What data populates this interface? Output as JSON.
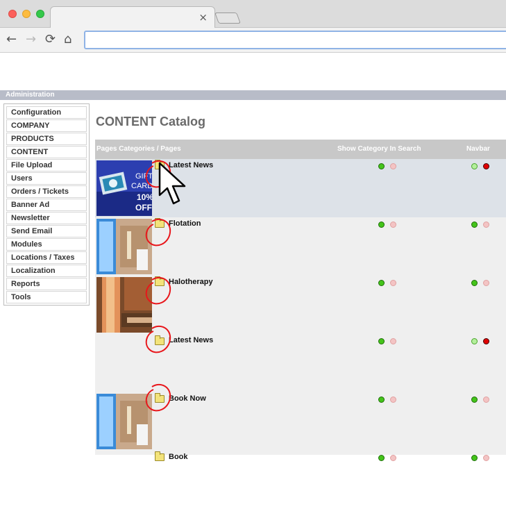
{
  "browser": {
    "tab_close": "×",
    "nav": {
      "back": "←",
      "forward": "→",
      "reload": "⟳",
      "home": "⌂"
    },
    "address_value": ""
  },
  "admin": {
    "header": "Administration"
  },
  "sidebar": {
    "items": [
      {
        "label": "Configuration"
      },
      {
        "label": "COMPANY"
      },
      {
        "label": "PRODUCTS"
      },
      {
        "label": "CONTENT"
      },
      {
        "label": "File Upload"
      },
      {
        "label": "Users"
      },
      {
        "label": "Orders / Tickets"
      },
      {
        "label": "Banner Ad"
      },
      {
        "label": "Newsletter"
      },
      {
        "label": "Send Email"
      },
      {
        "label": "Modules"
      },
      {
        "label": "Locations / Taxes"
      },
      {
        "label": "Localization"
      },
      {
        "label": "Reports"
      },
      {
        "label": "Tools"
      }
    ]
  },
  "main": {
    "title": "CONTENT Catalog",
    "columns": {
      "name": "Pages Categories / Pages",
      "search": "Show Category In Search",
      "navbar": "Navbar"
    },
    "rows": [
      {
        "label": "Latest News",
        "thumb": "gift-cards",
        "search": [
          "on",
          "off"
        ],
        "navbar": [
          "onlight",
          "red"
        ]
      },
      {
        "label": "Flotation",
        "thumb": "flotation",
        "search": [
          "on",
          "off"
        ],
        "navbar": [
          "on",
          "off"
        ]
      },
      {
        "label": "Halotherapy",
        "thumb": "halotherapy",
        "search": [
          "on",
          "off"
        ],
        "navbar": [
          "on",
          "off"
        ]
      },
      {
        "label": "Latest News",
        "thumb": "none",
        "search": [
          "on",
          "off"
        ],
        "navbar": [
          "onlight",
          "red"
        ]
      },
      {
        "label": "Book Now",
        "thumb": "flotation",
        "search": [
          "on",
          "off"
        ],
        "navbar": [
          "on",
          "off"
        ]
      },
      {
        "label": "Book",
        "thumb": "none",
        "search": [
          "on",
          "off"
        ],
        "navbar": [
          "on",
          "off"
        ]
      }
    ]
  },
  "thumb_text": {
    "line1": "GIFT",
    "line2": "CARDS",
    "line3": "10%",
    "line4": "OFF"
  },
  "colors": {
    "annotation_red": "#e8161b",
    "indicator_green": "#44c41a",
    "indicator_off": "#f3c4c4",
    "indicator_red": "#e00000",
    "header_gray": "#c8c8c8",
    "admin_bar": "#b8bcc8"
  }
}
